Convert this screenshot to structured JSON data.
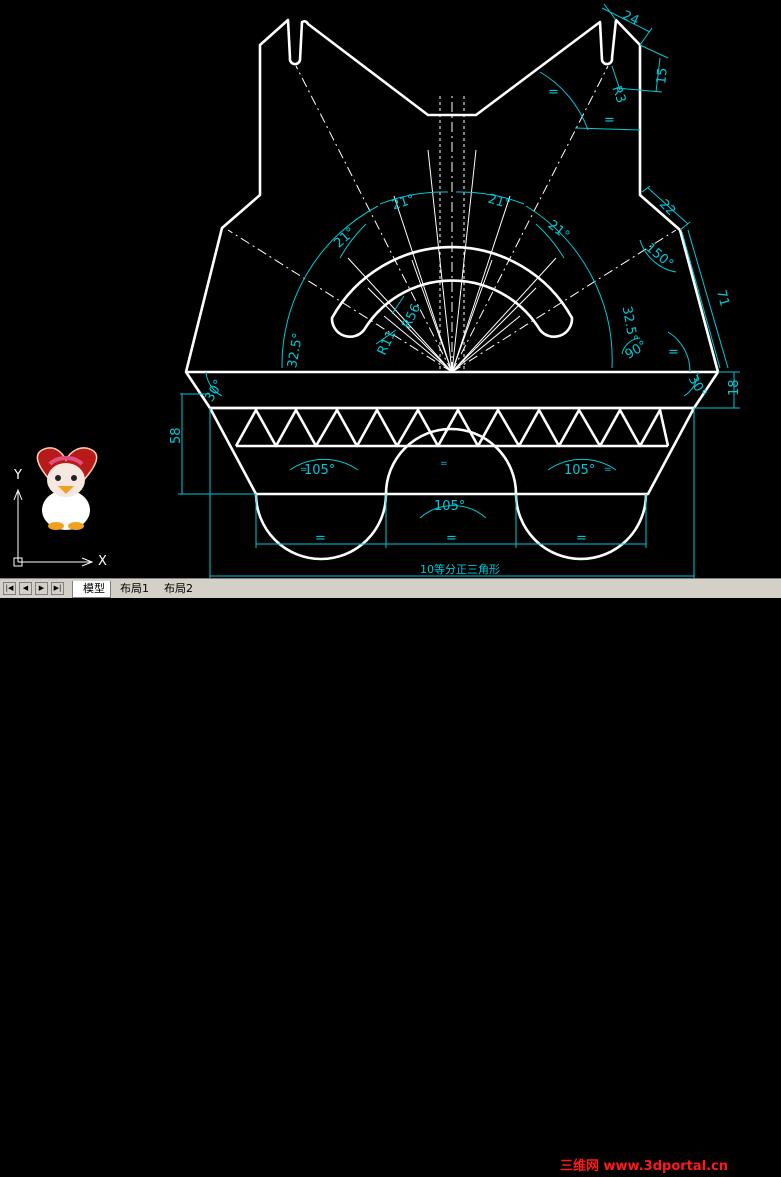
{
  "drawing": {
    "dimensions": {
      "top_width": "24",
      "slot_depth": "15",
      "slot_radius": "R3",
      "edge_right": "22",
      "height_right": "71",
      "angle_150": "150°",
      "angle_90": "90°",
      "height_band": "18",
      "height_left": "58",
      "angle_left_30": "30°",
      "angle_right_30": "30°",
      "angle_21_a": "21°",
      "angle_21_b": "21°",
      "angle_21_c": "21°",
      "angle_21_d": "21°",
      "angle_325_left": "32.5°",
      "angle_325_right": "32.5°",
      "radius_r56": "R56",
      "radius_r11": "R11",
      "angle_105_left": "105°",
      "angle_105_mid": "105°",
      "angle_105_right": "105°",
      "equal_1": "=",
      "equal_2": "=",
      "equal_3": "=",
      "equal_4": "=",
      "equal_5": "=",
      "equal_6": "=",
      "equal_7": "=",
      "equal_8": "=",
      "equal_9": "=",
      "bottom_note": "10等分正三角形"
    }
  },
  "ucs": {
    "y_label": "Y",
    "x_label": "X"
  },
  "tabs": [
    {
      "label": "模型",
      "active": true
    },
    {
      "label": "布局1",
      "active": false
    },
    {
      "label": "布局2",
      "active": false
    }
  ],
  "nav": {
    "first": "|◀",
    "prev": "◀",
    "next": "▶",
    "last": "▶|"
  },
  "watermark": {
    "text": "三维网 www.3dportal.cn"
  },
  "colors": {
    "background": "#000000",
    "outline": "#ffffff",
    "dimension": "#00c8d8",
    "watermark": "#ff1a1a"
  }
}
